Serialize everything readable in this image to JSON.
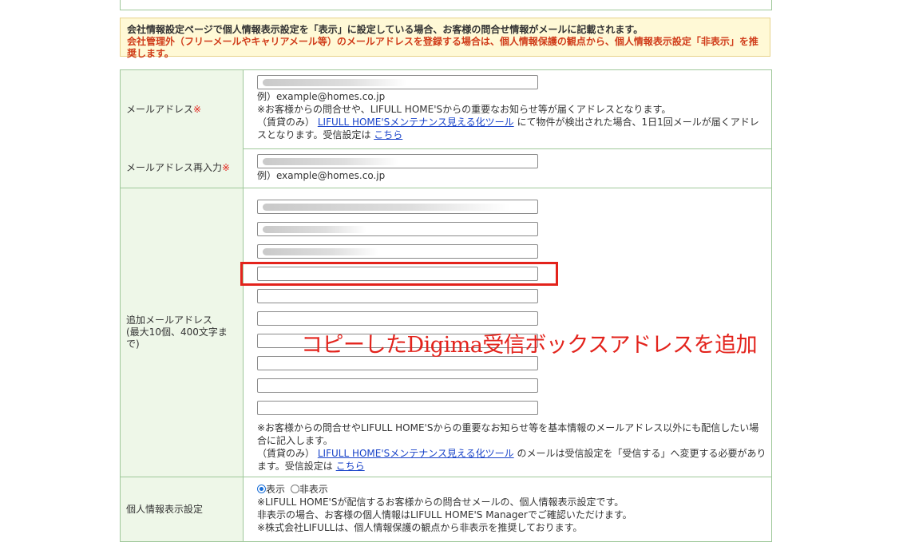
{
  "notice": {
    "line1": "会社情報設定ページで個人情報表示設定を「表示」に設定している場合、お客様の問合せ情報がメールに記載されます。",
    "line2": "会社管理外（フリーメールやキャリアメール等）のメールアドレスを登録する場合は、個人情報保護の観点から、個人情報表示設定「非表示」を推奨します。"
  },
  "email": {
    "label": "メールアドレス",
    "required_mark": "※",
    "example": "例）example@homes.co.jp",
    "note1": "※お客様からの問合せや、LIFULL HOME'Sからの重要なお知らせ等が届くアドレスとなります。",
    "note2_prefix": "（賃貸のみ）",
    "tool_link": "LIFULL HOME'Sメンテナンス見える化ツール",
    "note2_suffix": "にて物件が検出された場合、1日1回メールが届くアドレスとなります。受信設定は",
    "here_link": "こちら"
  },
  "email_confirm": {
    "label": "メールアドレス再入力",
    "required_mark": "※",
    "example": "例）example@homes.co.jp"
  },
  "additional": {
    "label_line1": "追加メールアドレス",
    "label_line2": "(最大10個、400文字まで)",
    "note1": "※お客様からの問合せやLIFULL HOME'Sからの重要なお知らせ等を基本情報のメールアドレス以外にも配信したい場合に記入します。",
    "note2_prefix": "（賃貸のみ）",
    "tool_link": "LIFULL HOME'Sメンテナンス見える化ツール",
    "note2_suffix": "のメールは受信設定を「受信する」へ変更する必要があります。受信設定は",
    "here_link": "こちら"
  },
  "privacy": {
    "label": "個人情報表示設定",
    "option_show": "表示",
    "option_hide": "非表示",
    "selected": "表示",
    "note1": "※LIFULL HOME'Sが配信するお客様からの問合せメールの、個人情報表示設定です。",
    "note2": "非表示の場合、お客様の個人情報はLIFULL HOME'S Managerでご確認いただけます。",
    "note3": "※株式会社LIFULLは、個人情報保護の観点から非表示を推奨しております。"
  },
  "annotation": "コピーしたDigima受信ボックスアドレスを追加",
  "colors": {
    "accent_red": "#e3231c",
    "link_blue": "#1a44c9",
    "header_green": "#eef7e8",
    "border_green": "#9fc89a",
    "notice_bg": "#fff9d6"
  }
}
